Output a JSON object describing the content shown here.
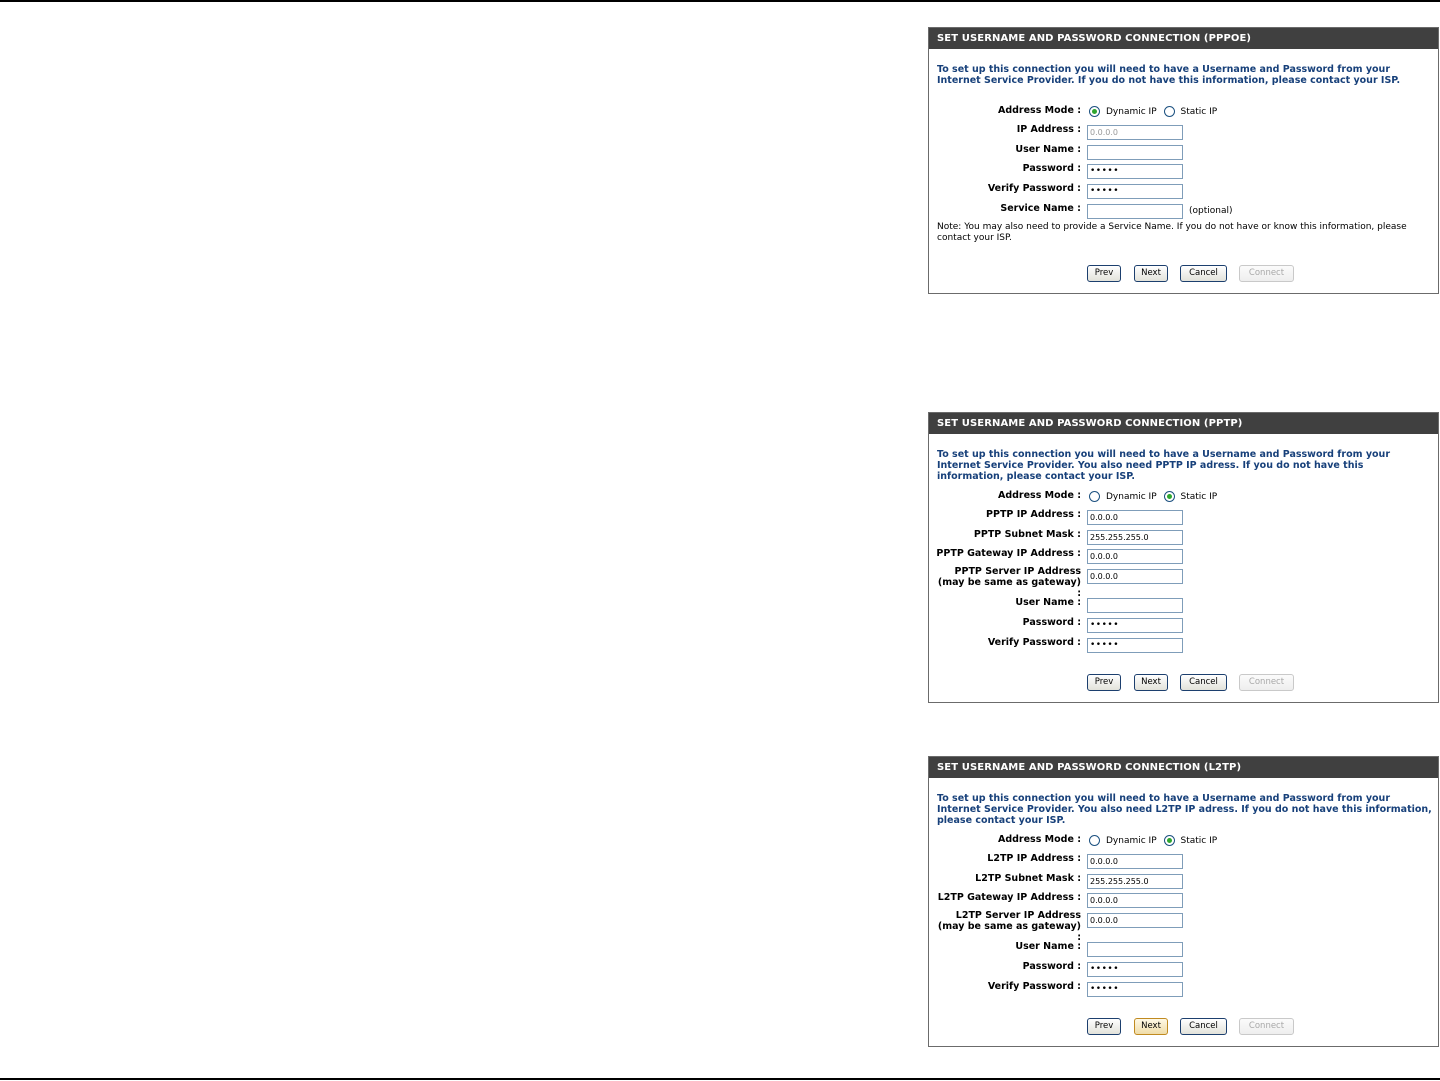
{
  "pppoe": {
    "title": "SET USERNAME AND PASSWORD CONNECTION (PPPOE)",
    "intro": "To set up this connection you will need to have a Username and Password from your Internet Service Provider. If you do not have this information, please contact your ISP.",
    "address_mode_label": "Address Mode :",
    "dynamic_label": "Dynamic IP",
    "static_label": "Static IP",
    "selected_mode": "Dynamic IP",
    "fields": [
      {
        "label": "IP Address :",
        "value": "0.0.0.0"
      },
      {
        "label": "User Name :",
        "value": ""
      },
      {
        "label": "Password :",
        "value": "•••••"
      },
      {
        "label": "Verify Password :",
        "value": "•••••"
      },
      {
        "label": "Service Name :",
        "value": ""
      }
    ],
    "optional_text": "(optional)",
    "note": "Note: You may also need to provide a Service Name. If you do not have or know this information, please contact your ISP.",
    "buttons": {
      "prev": "Prev",
      "next": "Next",
      "cancel": "Cancel",
      "connect": "Connect"
    }
  },
  "pptp": {
    "title": "SET USERNAME AND PASSWORD CONNECTION (PPTP)",
    "intro": "To set up this connection you will need to have a Username and Password from your Internet Service Provider. You also need PPTP IP adress. If you do not have this information, please contact your ISP.",
    "address_mode_label": "Address Mode :",
    "dynamic_label": "Dynamic IP",
    "static_label": "Static IP",
    "selected_mode": "Static IP",
    "fields": [
      {
        "label": "PPTP IP Address :",
        "value": "0.0.0.0"
      },
      {
        "label": "PPTP Subnet Mask :",
        "value": "255.255.255.0"
      },
      {
        "label": "PPTP Gateway IP Address :",
        "value": "0.0.0.0"
      },
      {
        "label": "PPTP Server IP Address (may be same as gateway) :",
        "value": "0.0.0.0"
      },
      {
        "label": "User Name :",
        "value": ""
      },
      {
        "label": "Password :",
        "value": "•••••"
      },
      {
        "label": "Verify Password :",
        "value": "•••••"
      }
    ],
    "buttons": {
      "prev": "Prev",
      "next": "Next",
      "cancel": "Cancel",
      "connect": "Connect"
    }
  },
  "l2tp": {
    "title": "SET USERNAME AND PASSWORD CONNECTION (L2TP)",
    "intro": "To set up this connection you will need to have a Username and Password from your Internet Service Provider. You also need L2TP IP adress. If you do not have this information, please contact your ISP.",
    "address_mode_label": "Address Mode :",
    "dynamic_label": "Dynamic IP",
    "static_label": "Static IP",
    "selected_mode": "Static IP",
    "fields": [
      {
        "label": "L2TP IP Address :",
        "value": "0.0.0.0"
      },
      {
        "label": "L2TP Subnet Mask :",
        "value": "255.255.255.0"
      },
      {
        "label": "L2TP Gateway IP Address :",
        "value": "0.0.0.0"
      },
      {
        "label": "L2TP Server IP Address (may be same as gateway) :",
        "value": "0.0.0.0"
      },
      {
        "label": "User Name :",
        "value": ""
      },
      {
        "label": "Password :",
        "value": "•••••"
      },
      {
        "label": "Verify Password :",
        "value": "•••••"
      }
    ],
    "buttons": {
      "prev": "Prev",
      "next": "Next",
      "cancel": "Cancel",
      "connect": "Connect"
    }
  },
  "colors": {
    "header_bg": "#404040",
    "intro_text": "#17407a",
    "radio_selected": "#2ea62e"
  }
}
